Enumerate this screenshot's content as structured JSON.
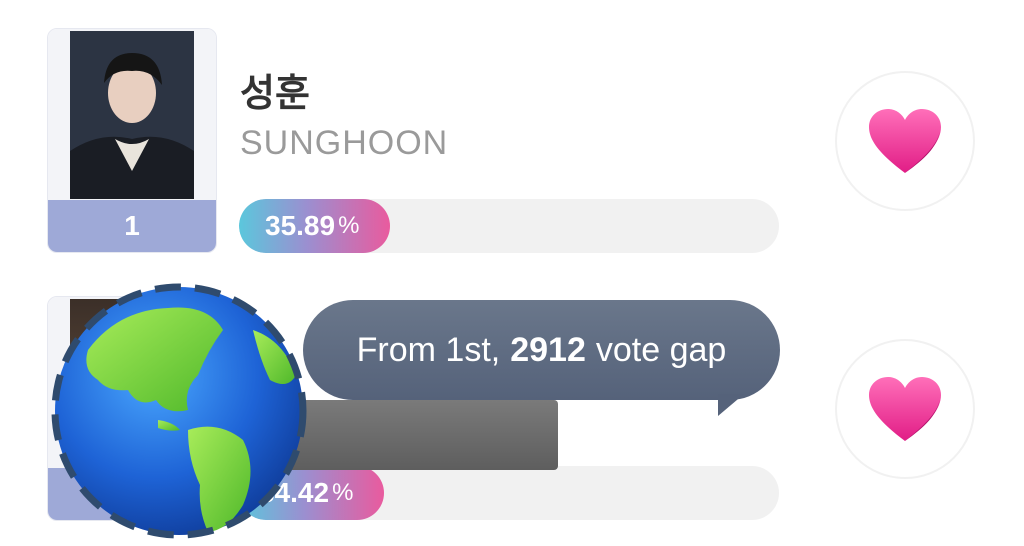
{
  "colors": {
    "rank_bg": "#9ea9d7",
    "bar_gradient_start": "#5bc7dc",
    "bar_gradient_end": "#e95b9e",
    "heart": "#f0409a",
    "tooltip_bg": "#5e6b82"
  },
  "candidates": [
    {
      "rank": "1",
      "name_ko": "성훈",
      "name_en": "SUNGHOON",
      "percent_value": "35.89",
      "percent_sign": "%",
      "fraction": 0.3589,
      "vote_icon": "heart-icon"
    },
    {
      "rank": "",
      "name_ko": "",
      "name_en": "",
      "percent_value": "34.42",
      "percent_sign": "%",
      "fraction": 0.3442,
      "vote_icon": "heart-icon"
    }
  ],
  "tooltip": {
    "prefix": "From 1st,",
    "gap_value": "2912",
    "suffix": "vote gap"
  },
  "overlay_icon": "globe-icon"
}
